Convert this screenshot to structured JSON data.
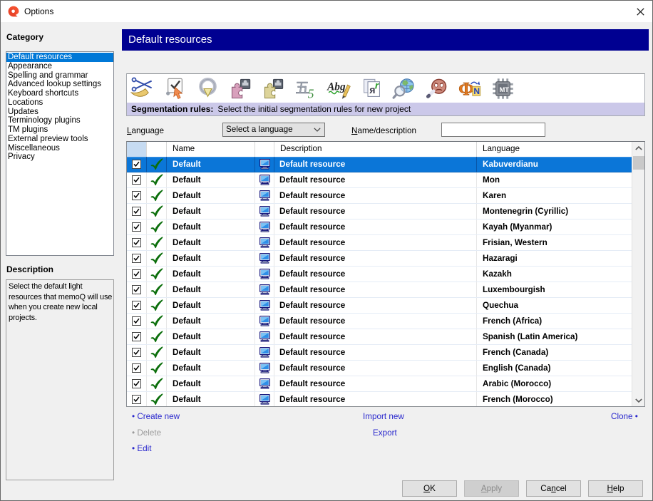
{
  "window": {
    "title": "Options"
  },
  "sidebar": {
    "category_label": "Category",
    "items": [
      {
        "label": "Default resources",
        "selected": true
      },
      {
        "label": "Appearance",
        "selected": false
      },
      {
        "label": "Spelling and grammar",
        "selected": false
      },
      {
        "label": "Advanced lookup settings",
        "selected": false
      },
      {
        "label": "Keyboard shortcuts",
        "selected": false
      },
      {
        "label": "Locations",
        "selected": false
      },
      {
        "label": "Updates",
        "selected": false
      },
      {
        "label": "Terminology plugins",
        "selected": false
      },
      {
        "label": "TM plugins",
        "selected": false
      },
      {
        "label": "External preview tools",
        "selected": false
      },
      {
        "label": "Miscellaneous",
        "selected": false
      },
      {
        "label": "Privacy",
        "selected": false
      }
    ],
    "description_label": "Description",
    "description_text": "Select the default light resources that memoQ will use when you create new local projects."
  },
  "main": {
    "header_title": "Default resources",
    "toolbar": {
      "icons": [
        "segmentation-rules-icon",
        "qa-settings-icon",
        "autotranslation-icon",
        "translation-memory-plugin-icon",
        "termbase-plugin-icon",
        "nontranslatables-icon",
        "ignore-lists-icon",
        "autocorrect-icon",
        "web-search-icon",
        "profanity-icon",
        "font-substitution-icon",
        "mt-settings-icon"
      ],
      "strip_label": "Segmentation rules:",
      "strip_text": "Select the initial segmentation rules for new project"
    },
    "filter": {
      "language_label": "Language",
      "language_underline_index": 0,
      "language_value": "Select a language",
      "name_label": "Name/description",
      "name_underline_index": 0,
      "name_value": ""
    },
    "table": {
      "columns": {
        "name": "Name",
        "description": "Description",
        "language": "Language"
      },
      "rows": [
        {
          "checked": true,
          "name": "Default",
          "description": "Default resource",
          "language": "Kabuverdianu",
          "selected": true
        },
        {
          "checked": true,
          "name": "Default",
          "description": "Default resource",
          "language": "Mon",
          "selected": false
        },
        {
          "checked": true,
          "name": "Default",
          "description": "Default resource",
          "language": "Karen",
          "selected": false
        },
        {
          "checked": true,
          "name": "Default",
          "description": "Default resource",
          "language": "Montenegrin (Cyrillic)",
          "selected": false
        },
        {
          "checked": true,
          "name": "Default",
          "description": "Default resource",
          "language": "Kayah (Myanmar)",
          "selected": false
        },
        {
          "checked": true,
          "name": "Default",
          "description": "Default resource",
          "language": "Frisian, Western",
          "selected": false
        },
        {
          "checked": true,
          "name": "Default",
          "description": "Default resource",
          "language": "Hazaragi",
          "selected": false
        },
        {
          "checked": true,
          "name": "Default",
          "description": "Default resource",
          "language": "Kazakh",
          "selected": false
        },
        {
          "checked": true,
          "name": "Default",
          "description": "Default resource",
          "language": "Luxembourgish",
          "selected": false
        },
        {
          "checked": true,
          "name": "Default",
          "description": "Default resource",
          "language": "Quechua",
          "selected": false
        },
        {
          "checked": true,
          "name": "Default",
          "description": "Default resource",
          "language": "French (Africa)",
          "selected": false
        },
        {
          "checked": true,
          "name": "Default",
          "description": "Default resource",
          "language": "Spanish (Latin America)",
          "selected": false
        },
        {
          "checked": true,
          "name": "Default",
          "description": "Default resource",
          "language": "French (Canada)",
          "selected": false
        },
        {
          "checked": true,
          "name": "Default",
          "description": "Default resource",
          "language": "English (Canada)",
          "selected": false
        },
        {
          "checked": true,
          "name": "Default",
          "description": "Default resource",
          "language": "Arabic (Morocco)",
          "selected": false
        },
        {
          "checked": true,
          "name": "Default",
          "description": "Default resource",
          "language": "French (Morocco)",
          "selected": false
        }
      ]
    },
    "links": {
      "create_new": "Create new",
      "delete": "Delete",
      "edit": "Edit",
      "import_new": "Import new",
      "export": "Export",
      "clone": "Clone"
    },
    "buttons": [
      {
        "label": "OK",
        "underline_index": 0,
        "disabled": false
      },
      {
        "label": "Apply",
        "underline_index": 0,
        "disabled": true
      },
      {
        "label": "Cancel",
        "underline_index": 2,
        "disabled": false
      },
      {
        "label": "Help",
        "underline_index": 0,
        "disabled": false
      }
    ]
  },
  "colors": {
    "header_navy": "#000091",
    "strip_lavender": "#cbc8e9",
    "selection_blue": "#0b76d8",
    "link_blue": "#2a28cd",
    "dialog_bg": "#f0f0f0"
  }
}
